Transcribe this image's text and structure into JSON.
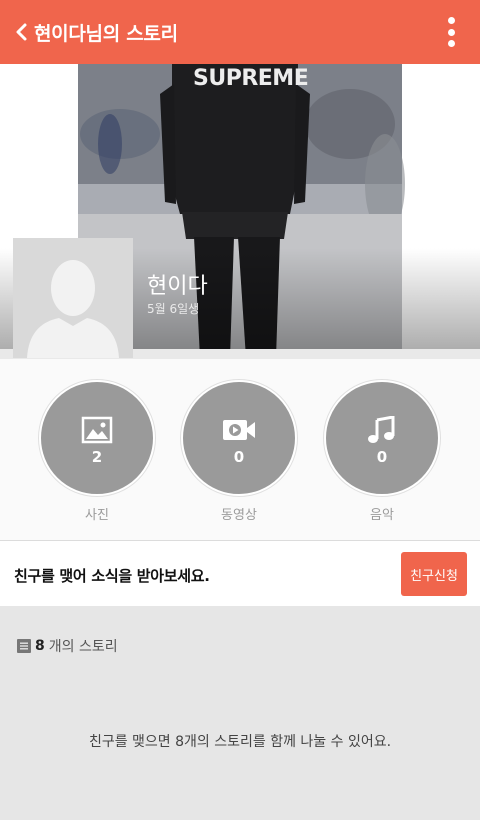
{
  "header": {
    "title": "현이다님의 스토리",
    "back_icon": "chevron-left-icon",
    "menu_icon": "more-vertical-icon",
    "color": "#f0654c"
  },
  "profile": {
    "cover_text": "SUPREME",
    "name": "현이다",
    "birthday": "5월 6일생",
    "avatar_icon": "default-avatar-icon"
  },
  "media": [
    {
      "label": "사진",
      "count": "2",
      "icon": "photo-icon"
    },
    {
      "label": "동영상",
      "count": "0",
      "icon": "video-icon"
    },
    {
      "label": "음악",
      "count": "0",
      "icon": "music-note-icon"
    }
  ],
  "friend": {
    "message": "친구를 맺어 소식을 받아보세요.",
    "button_label": "친구신청"
  },
  "stories": {
    "count": "8",
    "count_suffix": "개의 스토리",
    "list_icon": "list-icon",
    "message": "친구를 맺으면 8개의 스토리를 함께 나눌 수 있어요."
  }
}
